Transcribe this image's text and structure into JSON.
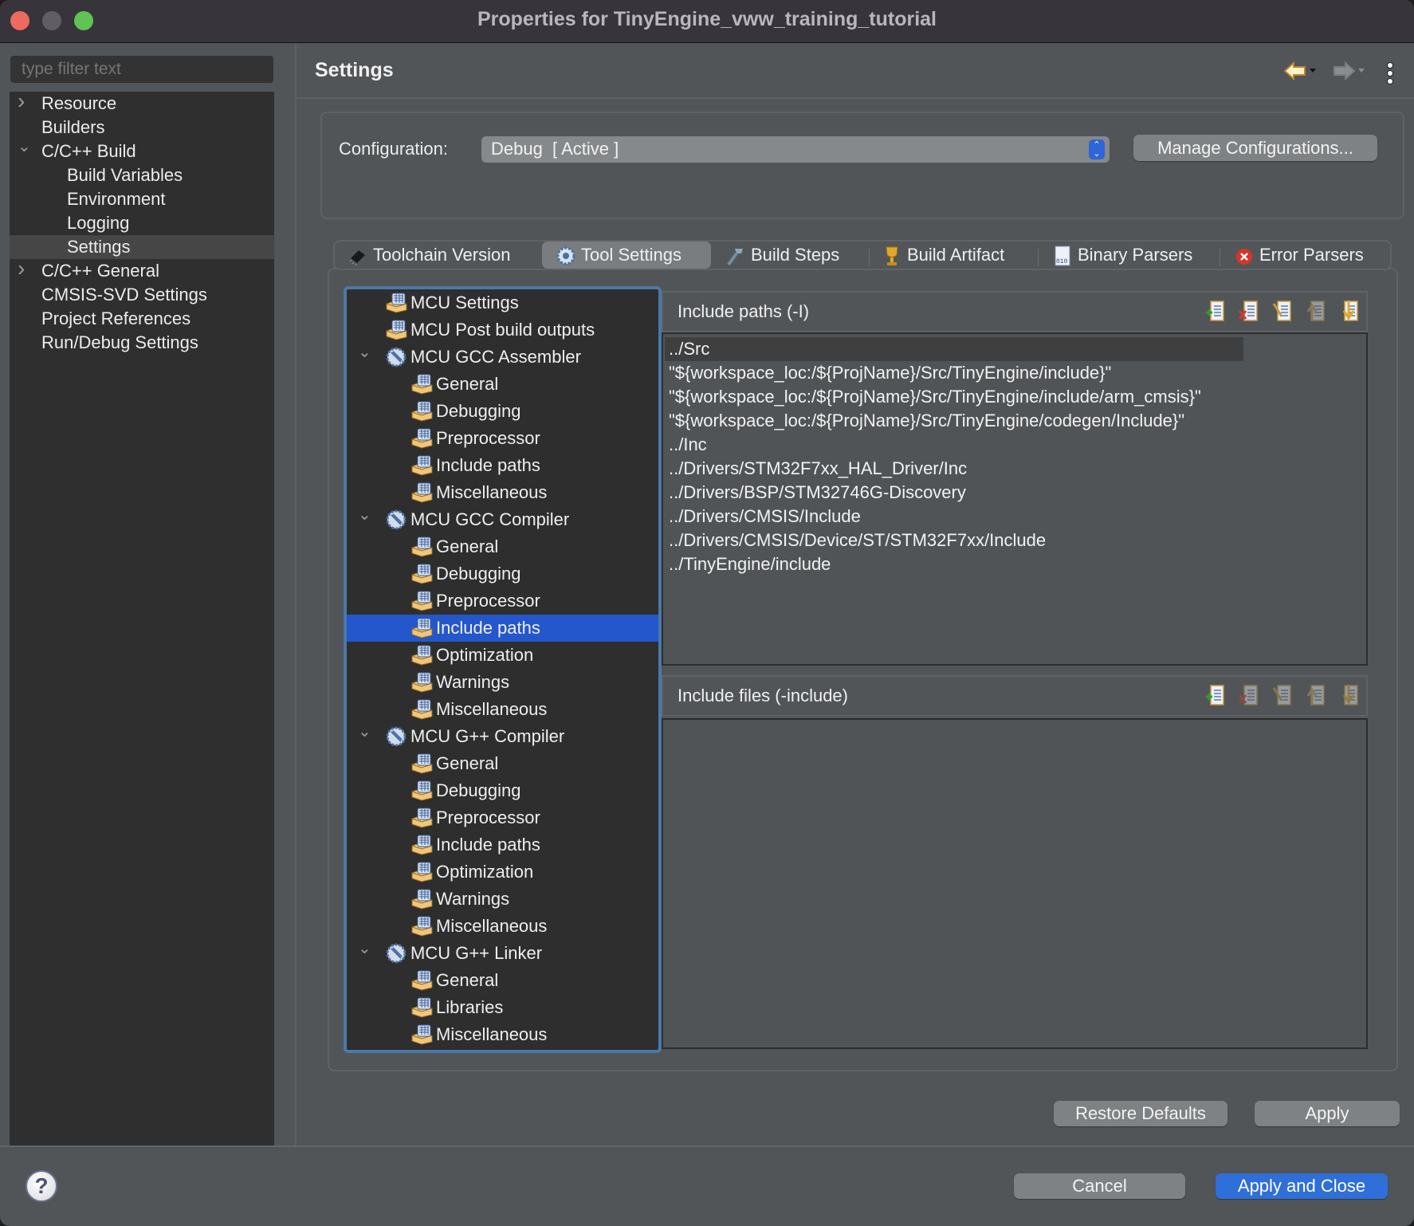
{
  "window": {
    "title": "Properties for TinyEngine_vww_training_tutorial",
    "controls": [
      "close",
      "minimize",
      "zoom"
    ]
  },
  "sidebar": {
    "filter_placeholder": "type filter text",
    "filter_value": "",
    "items": [
      {
        "label": "Resource",
        "level": 0,
        "expander": "collapsed"
      },
      {
        "label": "Builders",
        "level": 0,
        "expander": "none"
      },
      {
        "label": "C/C++ Build",
        "level": 0,
        "expander": "expanded"
      },
      {
        "label": "Build Variables",
        "level": 1,
        "expander": "none"
      },
      {
        "label": "Environment",
        "level": 1,
        "expander": "none"
      },
      {
        "label": "Logging",
        "level": 1,
        "expander": "none"
      },
      {
        "label": "Settings",
        "level": 1,
        "expander": "none",
        "selected": true
      },
      {
        "label": "C/C++ General",
        "level": 0,
        "expander": "collapsed"
      },
      {
        "label": "CMSIS-SVD Settings",
        "level": 0,
        "expander": "none"
      },
      {
        "label": "Project References",
        "level": 0,
        "expander": "none"
      },
      {
        "label": "Run/Debug Settings",
        "level": 0,
        "expander": "none"
      }
    ]
  },
  "header": {
    "title": "Settings",
    "back_icon": "back-arrow-icon",
    "forward_icon": "forward-arrow-icon",
    "menu_icon": "kebab-menu-icon"
  },
  "configuration": {
    "label": "Configuration:",
    "selected": "Debug  [ Active ]",
    "manage_button": "Manage Configurations..."
  },
  "tabs": [
    {
      "label": "Toolchain Version",
      "icon": "chip-icon",
      "active": false
    },
    {
      "label": "Tool Settings",
      "icon": "gear-icon",
      "active": true
    },
    {
      "label": "Build Steps",
      "icon": "hammer-icon",
      "active": false
    },
    {
      "label": "Build Artifact",
      "icon": "trophy-icon",
      "active": false
    },
    {
      "label": "Binary Parsers",
      "icon": "binary-file-icon",
      "active": false
    },
    {
      "label": "Error Parsers",
      "icon": "error-icon",
      "active": false
    }
  ],
  "tool_tree": [
    {
      "label": "MCU Settings",
      "level": 0,
      "type": "option",
      "expander": "none"
    },
    {
      "label": "MCU Post build outputs",
      "level": 0,
      "type": "option",
      "expander": "none"
    },
    {
      "label": "MCU GCC Assembler",
      "level": 0,
      "type": "tool",
      "expander": "expanded"
    },
    {
      "label": "General",
      "level": 1,
      "type": "option"
    },
    {
      "label": "Debugging",
      "level": 1,
      "type": "option"
    },
    {
      "label": "Preprocessor",
      "level": 1,
      "type": "option"
    },
    {
      "label": "Include paths",
      "level": 1,
      "type": "option"
    },
    {
      "label": "Miscellaneous",
      "level": 1,
      "type": "option"
    },
    {
      "label": "MCU GCC Compiler",
      "level": 0,
      "type": "tool",
      "expander": "expanded"
    },
    {
      "label": "General",
      "level": 1,
      "type": "option"
    },
    {
      "label": "Debugging",
      "level": 1,
      "type": "option"
    },
    {
      "label": "Preprocessor",
      "level": 1,
      "type": "option"
    },
    {
      "label": "Include paths",
      "level": 1,
      "type": "option",
      "selected": true
    },
    {
      "label": "Optimization",
      "level": 1,
      "type": "option"
    },
    {
      "label": "Warnings",
      "level": 1,
      "type": "option"
    },
    {
      "label": "Miscellaneous",
      "level": 1,
      "type": "option"
    },
    {
      "label": "MCU G++ Compiler",
      "level": 0,
      "type": "tool",
      "expander": "expanded"
    },
    {
      "label": "General",
      "level": 1,
      "type": "option"
    },
    {
      "label": "Debugging",
      "level": 1,
      "type": "option"
    },
    {
      "label": "Preprocessor",
      "level": 1,
      "type": "option"
    },
    {
      "label": "Include paths",
      "level": 1,
      "type": "option"
    },
    {
      "label": "Optimization",
      "level": 1,
      "type": "option"
    },
    {
      "label": "Warnings",
      "level": 1,
      "type": "option"
    },
    {
      "label": "Miscellaneous",
      "level": 1,
      "type": "option"
    },
    {
      "label": "MCU G++ Linker",
      "level": 0,
      "type": "tool",
      "expander": "expanded"
    },
    {
      "label": "General",
      "level": 1,
      "type": "option"
    },
    {
      "label": "Libraries",
      "level": 1,
      "type": "option"
    },
    {
      "label": "Miscellaneous",
      "level": 1,
      "type": "option"
    }
  ],
  "include_paths": {
    "title": "Include paths (-I)",
    "toolbar": [
      {
        "name": "add-icon",
        "enabled": true
      },
      {
        "name": "delete-icon",
        "enabled": true
      },
      {
        "name": "edit-icon",
        "enabled": true
      },
      {
        "name": "move-up-icon",
        "enabled": false
      },
      {
        "name": "move-down-icon",
        "enabled": true
      }
    ],
    "items": [
      "../Src",
      "\"${workspace_loc:/${ProjName}/Src/TinyEngine/include}\"",
      "\"${workspace_loc:/${ProjName}/Src/TinyEngine/include/arm_cmsis}\"",
      "\"${workspace_loc:/${ProjName}/Src/TinyEngine/codegen/Include}\"",
      "../Inc",
      "../Drivers/STM32F7xx_HAL_Driver/Inc",
      "../Drivers/BSP/STM32746G-Discovery",
      "../Drivers/CMSIS/Include",
      "../Drivers/CMSIS/Device/ST/STM32F7xx/Include",
      "../TinyEngine/include"
    ]
  },
  "include_files": {
    "title": "Include files (-include)",
    "toolbar": [
      {
        "name": "add-icon",
        "enabled": true
      },
      {
        "name": "delete-icon",
        "enabled": false
      },
      {
        "name": "edit-icon",
        "enabled": false
      },
      {
        "name": "move-up-icon",
        "enabled": false
      },
      {
        "name": "move-down-icon",
        "enabled": false
      }
    ],
    "items": []
  },
  "buttons": {
    "restore_defaults": "Restore Defaults",
    "apply": "Apply",
    "cancel": "Cancel",
    "apply_and_close": "Apply and Close",
    "help": "?"
  },
  "colors": {
    "accent": "#2f6fd9",
    "selection": "#2456cc",
    "tree_border": "#4b78a8"
  }
}
